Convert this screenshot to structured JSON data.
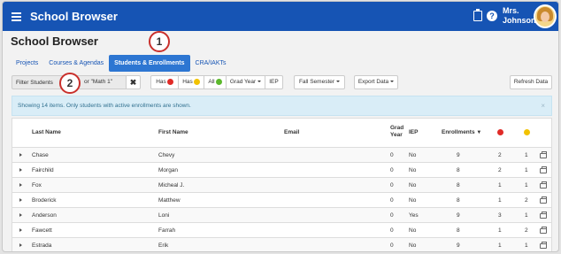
{
  "header": {
    "title": "School Browser",
    "user_line1": "Mrs.",
    "user_line2": "Johnson"
  },
  "page_title": "School Browser",
  "tabs": [
    {
      "label": "Projects"
    },
    {
      "label": "Courses & Agendas"
    },
    {
      "label": "Students & Enrollments"
    },
    {
      "label": "CRA/IAKTs"
    }
  ],
  "callouts": {
    "one": "1",
    "two": "2"
  },
  "toolbar": {
    "filter_placeholder": "Filter Students",
    "filter_hint": "or \"Math 1\"",
    "clear": "✖",
    "has_red": "Has",
    "has_yellow": "Has",
    "all": "All",
    "grad_year": "Grad Year",
    "iep": "IEP",
    "semester": "Fall Semester",
    "export": "Export Data",
    "refresh": "Refresh Data"
  },
  "colors": {
    "red": "#e02b27",
    "yellow": "#f2c200",
    "green": "#5cb82d",
    "brand": "#1654b4"
  },
  "info": {
    "message": "Showing 14 items. Only students with active enrollments are shown.",
    "close": "×"
  },
  "table": {
    "headers": {
      "last_name": "Last Name",
      "first_name": "First Name",
      "email": "Email",
      "grad_year_1": "Grad",
      "grad_year_2": "Year",
      "iep": "IEP",
      "enrollments": "Enrollments"
    },
    "rows": [
      {
        "last": "Chase",
        "first": "Chevy",
        "grad": "0",
        "iep": "No",
        "enroll": "9",
        "red": "2",
        "yellow": "1"
      },
      {
        "last": "Fairchild",
        "first": "Morgan",
        "grad": "0",
        "iep": "No",
        "enroll": "8",
        "red": "2",
        "yellow": "1"
      },
      {
        "last": "Fox",
        "first": "Micheal J.",
        "grad": "0",
        "iep": "No",
        "enroll": "8",
        "red": "1",
        "yellow": "1"
      },
      {
        "last": "Broderick",
        "first": "Matthew",
        "grad": "0",
        "iep": "No",
        "enroll": "8",
        "red": "1",
        "yellow": "2"
      },
      {
        "last": "Anderson",
        "first": "Loni",
        "grad": "0",
        "iep": "Yes",
        "enroll": "9",
        "red": "3",
        "yellow": "1"
      },
      {
        "last": "Fawcett",
        "first": "Farrah",
        "grad": "0",
        "iep": "No",
        "enroll": "8",
        "red": "1",
        "yellow": "2"
      },
      {
        "last": "Estrada",
        "first": "Erik",
        "grad": "0",
        "iep": "No",
        "enroll": "9",
        "red": "1",
        "yellow": "1"
      }
    ]
  }
}
